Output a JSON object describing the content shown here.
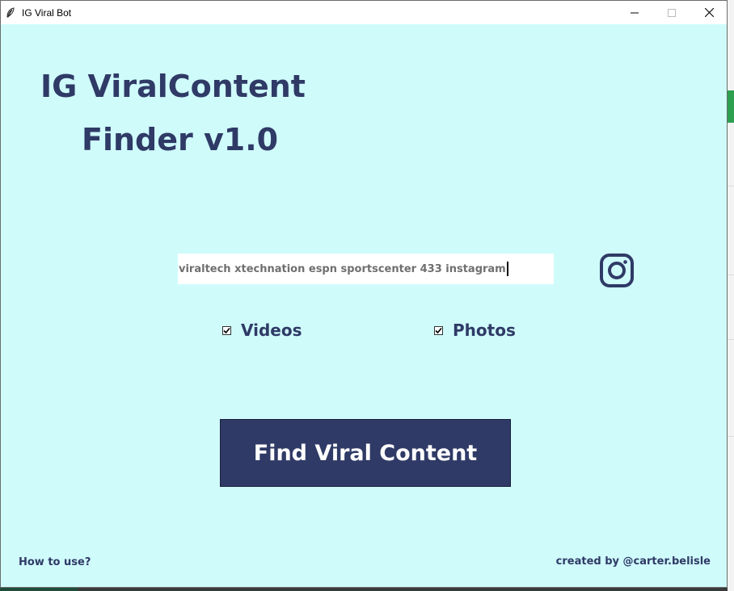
{
  "window": {
    "title": "IG Viral Bot",
    "icon": "feather-icon",
    "controls": {
      "minimize": "minimize-icon",
      "maximize": "maximize-icon",
      "close": "close-icon"
    }
  },
  "main": {
    "heading_line1": "IG ViralContent",
    "heading_line2": "Finder v1.0",
    "accounts_input_value": "viraltech xtechnation espn sportscenter 433 instagram",
    "instagram_icon": "instagram-icon",
    "videos_label": "Videos",
    "videos_checked": true,
    "photos_label": "Photos",
    "photos_checked": true,
    "find_button_label": "Find Viral Content"
  },
  "footer": {
    "help_link": "How to use?",
    "credit": "created by @carter.belisle"
  },
  "colors": {
    "background": "#cffbfb",
    "primary": "#2f3a66",
    "button_text": "#ffffff"
  }
}
